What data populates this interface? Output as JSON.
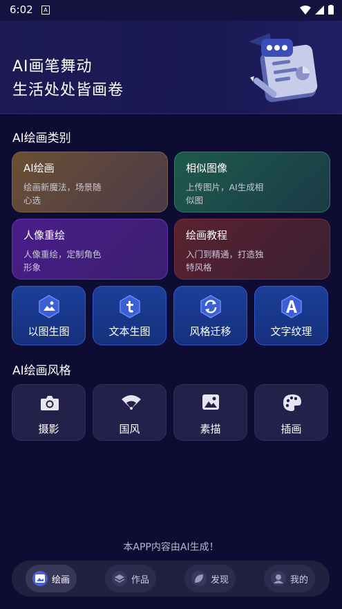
{
  "status_bar": {
    "time": "6:02",
    "notif_badge": "A"
  },
  "hero": {
    "line1": "AI画笔舞动",
    "line2": "生活处处皆画卷"
  },
  "categories": {
    "title": "AI绘画类别",
    "items": [
      {
        "title": "AI绘画",
        "desc": "绘画新魔法，场景随心选"
      },
      {
        "title": "相似图像",
        "desc": "上传图片，AI生成相似图"
      },
      {
        "title": "人像重绘",
        "desc": "人像重绘，定制角色形象"
      },
      {
        "title": "绘画教程",
        "desc": "入门到精通，打造独特风格"
      }
    ]
  },
  "tools": [
    {
      "label": "以图生图",
      "icon": "image-mountain-icon"
    },
    {
      "label": "文本生图",
      "icon": "text-t-icon"
    },
    {
      "label": "风格迁移",
      "icon": "refresh-icon"
    },
    {
      "label": "文字纹理",
      "icon": "letter-a-icon"
    }
  ],
  "styles": {
    "title": "AI绘画风格",
    "items": [
      {
        "label": "摄影",
        "icon": "camera-icon"
      },
      {
        "label": "国风",
        "icon": "fan-icon"
      },
      {
        "label": "素描",
        "icon": "picture-icon"
      },
      {
        "label": "插画",
        "icon": "palette-icon"
      }
    ]
  },
  "footer_note": "本APP内容由AI生成！",
  "nav": [
    {
      "label": "绘画",
      "icon": "paint-icon",
      "active": true
    },
    {
      "label": "作品",
      "icon": "layers-icon",
      "active": false
    },
    {
      "label": "发现",
      "icon": "leaf-icon",
      "active": false
    },
    {
      "label": "我的",
      "icon": "user-icon",
      "active": false
    }
  ],
  "colors": {
    "background": "#0e0c33",
    "accent": "#4a5fd0"
  }
}
